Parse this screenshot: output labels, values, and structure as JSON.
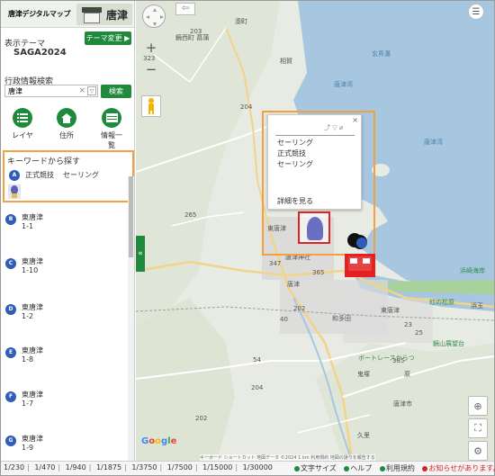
{
  "header": {
    "title": "唐津デジタルマップ",
    "logo_text": "唐津"
  },
  "theme": {
    "label": "表示テーマ",
    "change_button": "テーマ変更 ▶",
    "name": "SAGA2024"
  },
  "admin_search": {
    "label": "行政情報検索",
    "value": "唐津",
    "clear": "×",
    "dropdown": "▽",
    "button": "検索"
  },
  "tools": [
    {
      "label": "レイヤ",
      "icon": "list-icon"
    },
    {
      "label": "住所",
      "icon": "home-icon"
    },
    {
      "label": "情報一覧",
      "icon": "table-icon"
    }
  ],
  "keyword": {
    "title": "キーワードから探す",
    "badge": "A",
    "tag1": "正式競技",
    "tag2": "セーリング"
  },
  "results": [
    {
      "badge": "B",
      "name": "東唐津",
      "num": "1-1"
    },
    {
      "badge": "C",
      "name": "東唐津",
      "num": "1-10"
    },
    {
      "badge": "D",
      "name": "東唐津",
      "num": "1-2"
    },
    {
      "badge": "E",
      "name": "東唐津",
      "num": "1-8"
    },
    {
      "badge": "F",
      "name": "東唐津",
      "num": "1-7"
    },
    {
      "badge": "G",
      "name": "東唐津",
      "num": "1-9"
    }
  ],
  "sidebar_toggle": "«",
  "popup": {
    "close": "×",
    "tools": "⤴ ▽ ⌀",
    "line1": "セーリング",
    "line2": "正式競技",
    "line3": "セーリング",
    "more": "詳細を見る"
  },
  "map_labels": {
    "l1": "湊町",
    "l2": "鏡西町 菖蒲",
    "l3": "相賀",
    "l4": "東唐津",
    "l5": "唐津神社",
    "l6": "唐津",
    "l7": "和多田",
    "l8": "東唐津",
    "l9": "浜崎海岸",
    "l10": "鏡山展望台",
    "l11": "ボートレースからつ",
    "l12": "鬼塚",
    "l13": "唐津市",
    "l14": "久里",
    "l15": "浜玉",
    "l16": "虹の松原",
    "l17": "原",
    "l18": "唐津湾",
    "l19": "玄界灘",
    "l20": "唐津湾",
    "r1": "203",
    "r2": "323",
    "r3": "204",
    "r4": "265",
    "r5": "347",
    "r6": "365",
    "r7": "202",
    "r8": "40",
    "r9": "23",
    "r10": "25",
    "r11": "54",
    "r12": "385",
    "r13": "204",
    "r14": "202"
  },
  "zoom_in": "+",
  "zoom_out": "−",
  "google": {
    "g1": "G",
    "g2": "o",
    "g3": "o",
    "g4": "g",
    "g5": "l",
    "g6": "e"
  },
  "attribution": "キーボード ショートカット   地図データ ©2024   1 km   利用規約   地図の誤りを報告する",
  "scales": [
    "1/230",
    "1/470",
    "1/940",
    "1/1875",
    "1/3750",
    "1/7500",
    "1/15000",
    "1/30000"
  ],
  "scale_sep": "|",
  "bottom_links": {
    "text_size": "文字サイズ",
    "help": "ヘルプ",
    "terms": "利用規約",
    "notice": "お知らせがあります。"
  },
  "colors": {
    "accent": "#1f8a3b",
    "highlight": "#f2a040",
    "badge": "#2f5db8",
    "alert": "#e02222",
    "sea": "#a7c7e0"
  }
}
